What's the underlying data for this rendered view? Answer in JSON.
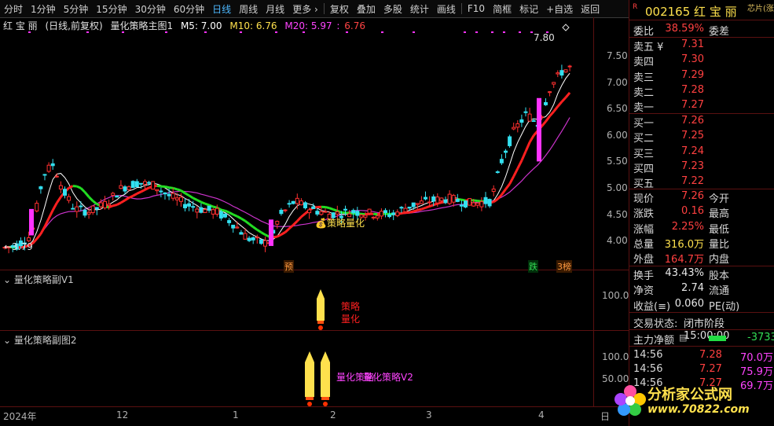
{
  "toolbar": {
    "items": [
      "分时",
      "1分钟",
      "5分钟",
      "15分钟",
      "30分钟",
      "60分钟",
      "日线",
      "周线",
      "月线",
      "更多 ›",
      "复权",
      "叠加",
      "多股",
      "统计",
      "画线",
      "F10",
      "简框",
      "标记",
      "+自选",
      "返回"
    ],
    "active": "日线"
  },
  "header": {
    "stock": "红 宝 丽",
    "mode": "(日线,前复权)",
    "indicator": "量化策略主图1",
    "ma5": "M5: 7.00",
    "ma10": "M10: 6.76",
    "ma20_label": "M20: 5.97",
    "ma20_extra": "6.76"
  },
  "colors": {
    "up": "#ff3030",
    "down": "#33e0f0",
    "ma_red": "#ff2020",
    "ma_white": "#ffffff",
    "ma_purple": "#cc33cc",
    "ma_green": "#22dd22",
    "magenta": "#ff33ff",
    "yellow": "#ffe14d"
  },
  "price_axis": [
    "7.50",
    "7.00",
    "6.50",
    "6.00",
    "5.50",
    "5.00",
    "4.50",
    "4.00"
  ],
  "main_annotations": {
    "high": "7.80",
    "low": "3.79",
    "strategy": "策略量化",
    "tag_yu": "预",
    "tag_die": "跌",
    "tag_bang": "榜"
  },
  "sub1": {
    "title": "量化策略副V1",
    "axis": "100.0",
    "text_a": "策略",
    "text_b": "量化"
  },
  "sub2": {
    "title": "量化策略副图2",
    "axis_a": "100.0",
    "axis_b": "50.00",
    "text_a": "量化策略",
    "text_b": "量化策略V2"
  },
  "xaxis": {
    "labels": [
      "2024年",
      "12",
      "1",
      "2",
      "3",
      "4",
      "日"
    ]
  },
  "right": {
    "code": "002165",
    "name": "红 宝 丽",
    "extra": "芯片(涨",
    "weibi_label": "委比",
    "weibi_value": "38.59%",
    "weicha_label": "委差",
    "sell": [
      {
        "l": "卖五 ¥",
        "v": "7.31"
      },
      {
        "l": "卖四",
        "v": "7.30"
      },
      {
        "l": "卖三",
        "v": "7.29"
      },
      {
        "l": "卖二",
        "v": "7.28"
      },
      {
        "l": "卖一",
        "v": "7.27"
      }
    ],
    "buy": [
      {
        "l": "买一",
        "v": "7.26"
      },
      {
        "l": "买二",
        "v": "7.25"
      },
      {
        "l": "买三",
        "v": "7.24"
      },
      {
        "l": "买四",
        "v": "7.23"
      },
      {
        "l": "买五",
        "v": "7.22"
      }
    ],
    "stats": [
      {
        "l": "现价",
        "v": "7.26",
        "l2": "今开"
      },
      {
        "l": "涨跌",
        "v": "0.16",
        "l2": "最高"
      },
      {
        "l": "涨幅",
        "v": "2.25%",
        "l2": "最低"
      },
      {
        "l": "总量",
        "v": "316.0万",
        "l2": "量比",
        "vc": "yellow"
      },
      {
        "l": "外盘",
        "v": "164.7万",
        "l2": "内盘"
      }
    ],
    "stats2": [
      {
        "l": "换手",
        "v": "43.43%",
        "l2": "股本",
        "vc": "white"
      },
      {
        "l": "净资",
        "v": "2.74",
        "l2": "流通",
        "vc": "white"
      },
      {
        "l": "收益(≡)",
        "v": "0.060",
        "l2": "PE(动)",
        "vc": "white"
      }
    ],
    "status_label": "交易状态:",
    "status_value": "闭市阶段 15:00:00",
    "netflow_label": "主力净额",
    "netflow_value": "-3733",
    "ticks": [
      {
        "t": "14:56",
        "p": "7.28",
        "v": "70.0万"
      },
      {
        "t": "14:56",
        "p": "7.27",
        "v": "75.9万"
      },
      {
        "t": "14:56",
        "p": "7.27",
        "v": "69.7万"
      }
    ]
  },
  "watermark": {
    "text": "分析家公式网",
    "url": "www.70822.com"
  }
}
